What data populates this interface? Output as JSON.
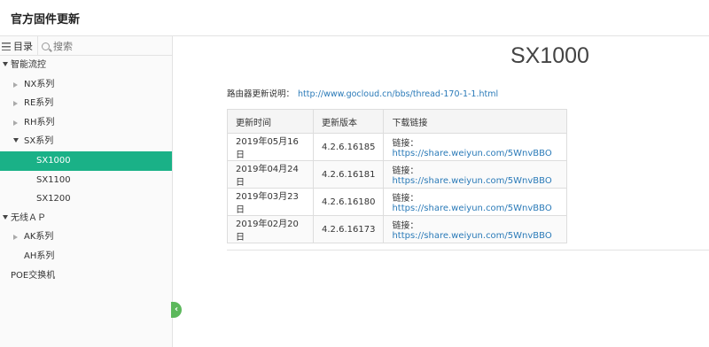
{
  "header": {
    "title": "官方固件更新"
  },
  "sidebar": {
    "toc_label": "目录",
    "search_placeholder": "搜索",
    "tree": [
      {
        "label": "智能流控",
        "level": 0,
        "expanded": true
      },
      {
        "label": "NX系列",
        "level": 1,
        "expanded": false
      },
      {
        "label": "RE系列",
        "level": 1,
        "expanded": false
      },
      {
        "label": "RH系列",
        "level": 1,
        "expanded": false
      },
      {
        "label": "SX系列",
        "level": 1,
        "expanded": true
      },
      {
        "label": "SX1000",
        "level": 2,
        "active": true
      },
      {
        "label": "SX1100",
        "level": 2
      },
      {
        "label": "SX1200",
        "level": 2
      },
      {
        "label": "无线ＡＰ",
        "level": 0,
        "expanded": true
      },
      {
        "label": "AK系列",
        "level": 1,
        "expanded": false
      },
      {
        "label": "AH系列",
        "level": 1
      },
      {
        "label": "POE交换机",
        "level": 0
      }
    ],
    "collapse_glyph": "‹"
  },
  "main": {
    "title": "SX1000",
    "desc_label": "路由器更新说明：",
    "desc_link": "http://www.gocloud.cn/bbs/thread-170-1-1.html",
    "table": {
      "headers": [
        "更新时间",
        "更新版本",
        "下载链接"
      ],
      "rows": [
        {
          "date": "2019年05月16日",
          "version": "4.2.6.16185",
          "link_label": "链接：",
          "link": "https://share.weiyun.com/5WnvBBO"
        },
        {
          "date": "2019年04月24日",
          "version": "4.2.6.16181",
          "link_label": "链接：",
          "link": "https://share.weiyun.com/5WnvBBO"
        },
        {
          "date": "2019年03月23日",
          "version": "4.2.6.16180",
          "link_label": "链接：",
          "link": "https://share.weiyun.com/5WnvBBO"
        },
        {
          "date": "2019年02月20日",
          "version": "4.2.6.16173",
          "link_label": "链接：",
          "link": "https://share.weiyun.com/5WnvBBO"
        }
      ]
    }
  },
  "colors": {
    "accent": "#1ab187",
    "link": "#2a7ab8",
    "collapse": "#5cb85c"
  }
}
